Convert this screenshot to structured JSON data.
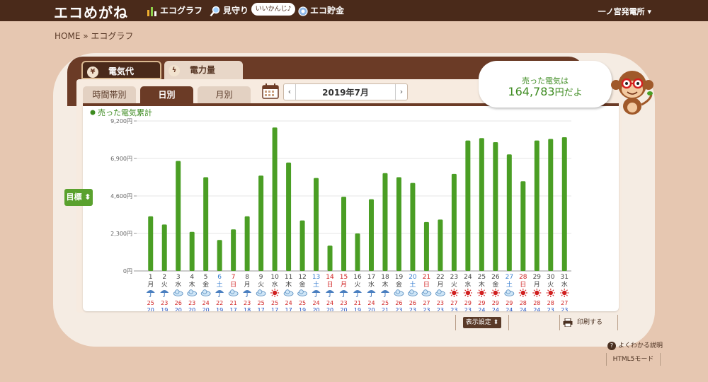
{
  "header": {
    "logo": "エコめがね",
    "nav": [
      {
        "label": "エコグラフ",
        "icon": "bar-chart-icon"
      },
      {
        "label": "見守り",
        "icon": "magnifier-icon"
      },
      {
        "label": "エコ貯金",
        "icon": "coin-icon"
      }
    ],
    "bubble": "いいかんじ♪",
    "plant_menu": "一ノ宮発電所"
  },
  "breadcrumb": "HOME » エコグラフ",
  "top_tabs": [
    {
      "label": "電気代",
      "icon": "yen-icon",
      "active": true
    },
    {
      "label": "電力量",
      "icon": "lightning-icon",
      "active": false
    }
  ],
  "period_tabs": [
    {
      "label": "時間帯別",
      "active": false
    },
    {
      "label": "日別",
      "active": true
    },
    {
      "label": "月別",
      "active": false
    }
  ],
  "date_nav": {
    "prev": "‹",
    "label": "2019年7月",
    "next": "›"
  },
  "goal_button": "目標 ⬍",
  "speech": {
    "line1": "売った電気は",
    "value": "164,783",
    "suffix": "円だよ"
  },
  "controls": {
    "display_settings": "表示設定 ⬍",
    "print": "印刷する",
    "help": "よくわかる説明",
    "html5": "HTML5モード"
  },
  "colors": {
    "bar": "#4a9e24",
    "saturday": "#3a7fd0",
    "sunday": "#d02020",
    "legend": "#3d8b20",
    "high_temp": "#d02020",
    "low_temp": "#2050c0"
  },
  "chart_data": {
    "type": "bar",
    "legend": "売った電気累計",
    "ylim": [
      0,
      9200
    ],
    "yticks": [
      "0円",
      "2,300円",
      "4,600円",
      "6,900円",
      "9,200円"
    ],
    "grid": true,
    "categories": [
      "1",
      "2",
      "3",
      "4",
      "5",
      "6",
      "7",
      "8",
      "9",
      "10",
      "11",
      "12",
      "13",
      "14",
      "15",
      "16",
      "17",
      "18",
      "19",
      "20",
      "21",
      "22",
      "23",
      "24",
      "25",
      "26",
      "27",
      "28",
      "29",
      "30",
      "31"
    ],
    "weekdays": [
      "月",
      "火",
      "水",
      "木",
      "金",
      "土",
      "日",
      "月",
      "火",
      "水",
      "木",
      "金",
      "土",
      "日",
      "月",
      "火",
      "水",
      "木",
      "金",
      "土",
      "日",
      "月",
      "火",
      "水",
      "木",
      "金",
      "土",
      "日",
      "月",
      "火",
      "水"
    ],
    "day_types": [
      "w",
      "w",
      "w",
      "w",
      "w",
      "sat",
      "sun",
      "w",
      "w",
      "w",
      "w",
      "w",
      "sat",
      "sun",
      "hol",
      "w",
      "w",
      "w",
      "w",
      "sat",
      "sun",
      "w",
      "w",
      "w",
      "w",
      "w",
      "sat",
      "sun",
      "w",
      "w",
      "w"
    ],
    "values": [
      3350,
      2850,
      6750,
      2400,
      5750,
      1900,
      2550,
      3350,
      5850,
      8800,
      6650,
      3100,
      5700,
      1550,
      4550,
      2300,
      4400,
      6000,
      5750,
      5400,
      3000,
      3150,
      5950,
      8000,
      8150,
      7900,
      7150,
      5500,
      8000,
      8100,
      8200
    ],
    "weather": [
      "umbrella",
      "umbrella",
      "cloud",
      "cloud",
      "cloud",
      "umbrella",
      "cloud",
      "umbrella",
      "cloud",
      "sun",
      "cloud",
      "cloud",
      "umbrella",
      "umbrella",
      "umbrella",
      "umbrella",
      "umbrella",
      "umbrella",
      "cloud",
      "cloud",
      "cloud",
      "cloud",
      "sun",
      "sun",
      "sun",
      "sun",
      "cloud",
      "sun",
      "sun",
      "sun",
      "sun"
    ],
    "high_temp": [
      25,
      23,
      26,
      23,
      24,
      22,
      21,
      23,
      25,
      25,
      24,
      25,
      24,
      24,
      23,
      21,
      24,
      25,
      26,
      26,
      27,
      23,
      27,
      29,
      29,
      29,
      29,
      28,
      28,
      28,
      27
    ],
    "low_temp": [
      20,
      19,
      20,
      20,
      20,
      19,
      17,
      18,
      17,
      17,
      17,
      19,
      20,
      20,
      20,
      19,
      20,
      21,
      23,
      23,
      23,
      23,
      23,
      23,
      24,
      24,
      24,
      24,
      24,
      23,
      23
    ]
  }
}
